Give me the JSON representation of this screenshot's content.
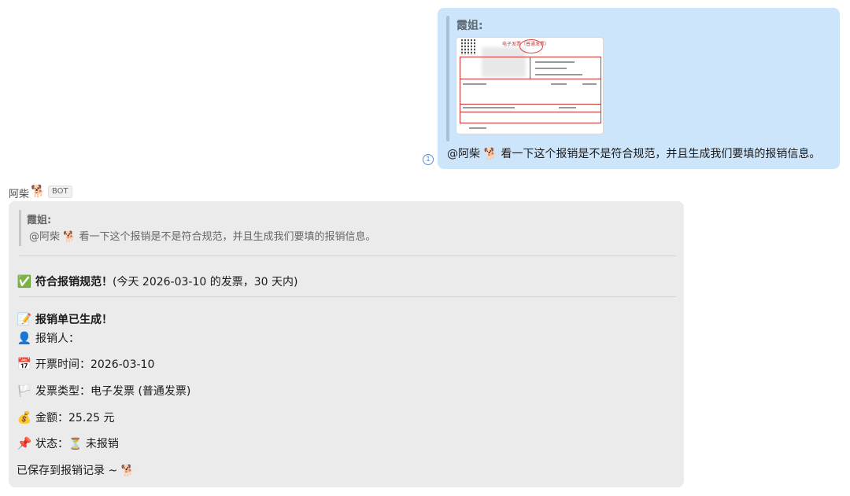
{
  "outgoing": {
    "quote_sender": "霞姐:",
    "invoice_title": "电子发票（普通发票）",
    "message": "@阿柴 🐕 看一下这个报销是不是符合规范，并且生成我们要填的报销信息。",
    "read_indicator": "1"
  },
  "bot": {
    "name": "阿柴",
    "avatar_emoji": "🐕",
    "badge": "BOT"
  },
  "reply": {
    "quote_sender": "霞姐:",
    "quote_text": "@阿柴 🐕 看一下这个报销是不是符合规范，并且生成我们要填的报销信息。",
    "compliance": {
      "emoji": "✅",
      "title": "符合报销规范！",
      "note": "(今天 2026-03-10 的发票，30 天内)"
    },
    "generated": {
      "emoji": "📝",
      "title": "报销单已生成！"
    },
    "fields": [
      {
        "emoji": "👤",
        "label": "报销人：",
        "value": ""
      },
      {
        "emoji": "📅",
        "label": "开票时间：",
        "value": "2026-03-10"
      },
      {
        "emoji": "🏳️",
        "label": "发票类型：",
        "value": "电子发票 (普通发票)"
      },
      {
        "emoji": "💰",
        "label": "金额：",
        "value": "25.25 元"
      },
      {
        "emoji": "📌",
        "label": "状态：",
        "value": "⏳ 未报销"
      }
    ],
    "footer": "已保存到报销记录 ~ 🐕"
  }
}
